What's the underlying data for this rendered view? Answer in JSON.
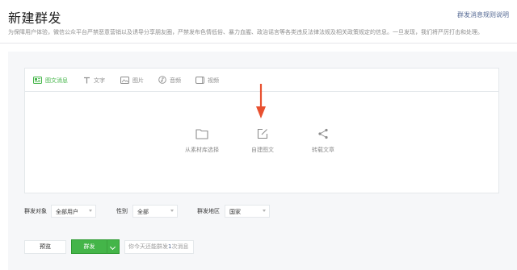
{
  "header": {
    "title": "新建群发",
    "rules_link": "群发消息规则说明",
    "notice": "为保障用户体验，微信公众平台严禁恶意营销以及诱导分享朋友圈，严禁发布色情低俗、暴力血腥、政治谣言等各类违反法律法规及相关政策规定的信息。一旦发现，我们将严厉打击和处理。"
  },
  "tabs": [
    {
      "label": "图文消息",
      "icon": "image-text-icon",
      "active": true
    },
    {
      "label": "文字",
      "icon": "text-icon",
      "active": false
    },
    {
      "label": "图片",
      "icon": "picture-icon",
      "active": false
    },
    {
      "label": "音频",
      "icon": "audio-icon",
      "active": false
    },
    {
      "label": "视频",
      "icon": "video-icon",
      "active": false
    }
  ],
  "actions": [
    {
      "label": "从素材库选择",
      "icon": "folder-icon"
    },
    {
      "label": "自建图文",
      "icon": "edit-icon"
    },
    {
      "label": "转载文章",
      "icon": "share-icon"
    }
  ],
  "filters": {
    "target_label": "群发对象",
    "target_value": "全部用户",
    "gender_label": "性别",
    "gender_value": "全部",
    "region_label": "群发地区",
    "region_value": "国家"
  },
  "footer": {
    "preview_label": "预览",
    "send_label": "群发",
    "quota_prefix": "你今天还能群发",
    "quota_count": "1",
    "quota_suffix": "次消息"
  },
  "colors": {
    "accent": "#44b549",
    "link": "#576b95",
    "arrow": "#e8502f"
  }
}
